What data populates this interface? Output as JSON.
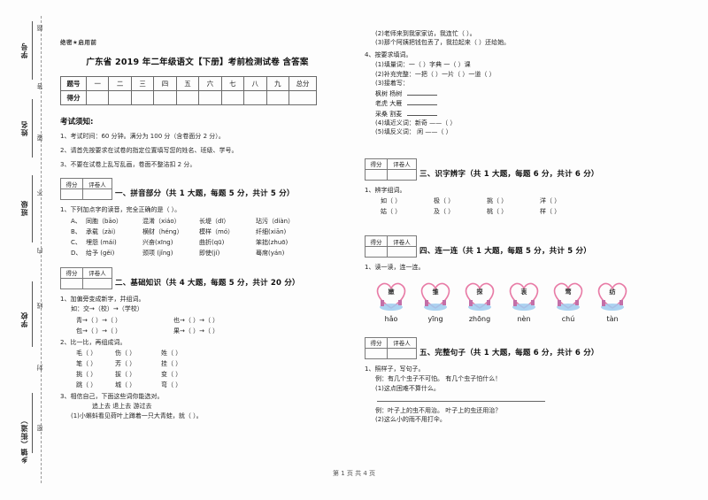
{
  "document": {
    "confidential_tag": "绝密★启用前",
    "title": "广东省 2019 年二年级语文【下册】考前检测试卷 含答案",
    "footer": "第 1 页 共 4 页"
  },
  "margin": {
    "seal_text": "密  封  线  内  不  要  答  题",
    "fields": [
      {
        "label": "学号"
      },
      {
        "label": "姓名"
      },
      {
        "label": "班级"
      },
      {
        "label": "学校"
      },
      {
        "label": "乡镇（街道）"
      }
    ]
  },
  "score_table": {
    "row_labels": [
      "题号",
      "得分"
    ],
    "columns": [
      "一",
      "二",
      "三",
      "四",
      "五",
      "六",
      "七",
      "八",
      "九"
    ],
    "total_label": "总分"
  },
  "notice": {
    "title": "考试须知:",
    "lines": [
      "1、考试时间：60 分钟。满分为 100 分（含卷面分 2 分）。",
      "2、请首先按要求在试卷的指定位置填写您的姓名、班级、学号。",
      "3、不要在试卷上乱写乱画，卷面不整洁扣 2 分。"
    ]
  },
  "grader": {
    "score_label": "得分",
    "marker_label": "评卷人"
  },
  "sections": [
    {
      "id": "s1",
      "title": "一、拼音部分（共 1 大题，每题 5 分，共计 5 分）",
      "q1": "1、下列加点字的读音，完全正确的是（    ）。",
      "options": [
        {
          "lead": "A、",
          "items": [
            "同胞（bāo）",
            "混淆（xiáo）",
            "长堤（dī）",
            "玷污（diàn）"
          ]
        },
        {
          "lead": "B、",
          "items": [
            "承载（zài）",
            "横财（héng）",
            "模样（mó）",
            "纤细(xiān)"
          ]
        },
        {
          "lead": "C、",
          "items": [
            "埋怨 (mái)",
            "兴奋(xīng)",
            "曲折(qū)",
            "笨拙(zhuō)"
          ]
        },
        {
          "lead": "D、",
          "items": [
            "给予 (gěi)",
            "颈项 (jǐng)",
            "即使(jí)",
            "蓦席(yán)"
          ]
        }
      ]
    },
    {
      "id": "s2",
      "title": "二、基础知识（共 4 大题，每题 5 分，共计 20 分）",
      "q1": "1、加偏旁变成新字，并组词。",
      "q1_example": "如：交→（校）→（学校）",
      "q1_rows": [
        [
          "青→（    ）→（        ）",
          "也→（    ）→（        ）"
        ],
        [
          "包→（    ）→（        ）",
          "果→（    ）→（        ）"
        ]
      ],
      "q2": "2、比一比，再组成词。",
      "q2_rows": [
        [
          "毛（  ）",
          "伤（    ）",
          "姓（    ）"
        ],
        [
          "笔（  ）",
          "芳（    ）",
          "挂（    ）"
        ],
        [
          "挑（  ）",
          "拔（    ）",
          "变（    ）"
        ],
        [
          "跳（  ）",
          "城（    ）",
          "弯（    ）"
        ]
      ],
      "q3": "3、相信自己，下面这些词你能选对。",
      "q3_words": "追上去      退上去      游过去",
      "q3_items": [
        "(1)小蝌蚪看见荷叶上蹲着一只大青蛙，就（         ）。",
        "(2)老师来到我家家访，我连忙（         ）。",
        "(3)那个阿姨把钱包丢了，我拉起来（        ）还给她。"
      ],
      "q4": "4、按要求填词。",
      "q4_items": [
        "(1)填量词：一（    ）字典   一（    ）课",
        "(2)补充完整：一把（    ）一片（    ）一道（     ）",
        "(3)接着写："
      ],
      "q4_writing": [
        {
          "pair": "枫树    杨树"
        },
        {
          "pair": "老虎   大雁"
        },
        {
          "pair": "采桑    割麦"
        }
      ],
      "q4_tail": [
        "(4)填近义词：新奇 ——（      ）",
        "(5)填反义词：  闲 ——（      ）"
      ]
    },
    {
      "id": "s3",
      "title": "三、识字辨字（共 1 大题，每题 6 分，共计 6 分）",
      "q1": "1、辨字组词。",
      "rows": [
        [
          "如（    ）",
          "极（    ）",
          "挑（    ）",
          "洋（    ）"
        ],
        [
          "姑（    ）",
          "及（    ）",
          "桃（    ）",
          "样（    ）"
        ]
      ]
    },
    {
      "id": "s4",
      "title": "四、连一连（共 1 大题，每题 5 分，共计 5 分）",
      "q1": "1、读一读，连一连。",
      "pictures": [
        {
          "char": "嫩",
          "pinyin": "hǎo"
        },
        {
          "char": "雏",
          "pinyin": "yīng"
        },
        {
          "char": "探",
          "pinyin": "zhōng"
        },
        {
          "char": "衷",
          "pinyin": "nèn"
        },
        {
          "char": "莺",
          "pinyin": "chú"
        },
        {
          "char": "纺",
          "pinyin": "tàn"
        }
      ]
    },
    {
      "id": "s5",
      "title": "五、完整句子（共 1 大题，每题 6 分，共计 6 分）",
      "q1": "1、照样子，写句子。",
      "example1": "例：有几个虫子不可怕。      有几个虫子怕什么！",
      "item1": "(1)这点困难不算什么。",
      "example2": "例：叶子上的虫不用治。      叶子上的虫还用治？",
      "item2": "(2)这么小的雨不用打伞。"
    }
  ],
  "colors": {
    "heart_stroke": "#e87ba6",
    "heart_base": "#7fb6e0",
    "rule": "#6a6a6a"
  }
}
